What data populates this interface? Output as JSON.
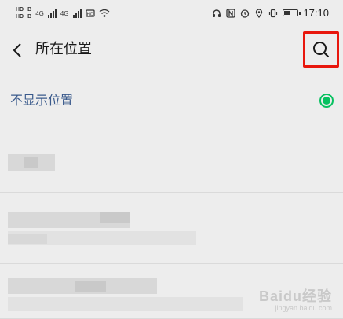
{
  "status_bar": {
    "left_labels": [
      "HD",
      "B",
      "4G",
      "HD",
      "B",
      "4G",
      "4G"
    ],
    "time": "17:10",
    "battery_level": 0.6,
    "icons": [
      "signal-icon",
      "wifi-icon",
      "headset-icon",
      "nfc-icon",
      "alarm-icon",
      "location-icon",
      "vibrate-icon",
      "battery-icon"
    ]
  },
  "header": {
    "title": "所在位置",
    "back_icon": "chevron-left-icon",
    "search_icon": "search-icon",
    "highlight_color": "#e8170d"
  },
  "options": [
    {
      "label": "不显示位置",
      "selected": true
    }
  ],
  "colors": {
    "selected_label": "#3a5a8c",
    "radio": "#07c160",
    "background": "#ededed"
  },
  "watermark": {
    "main": "Baidu经验",
    "sub": "jingyan.baidu.com"
  }
}
